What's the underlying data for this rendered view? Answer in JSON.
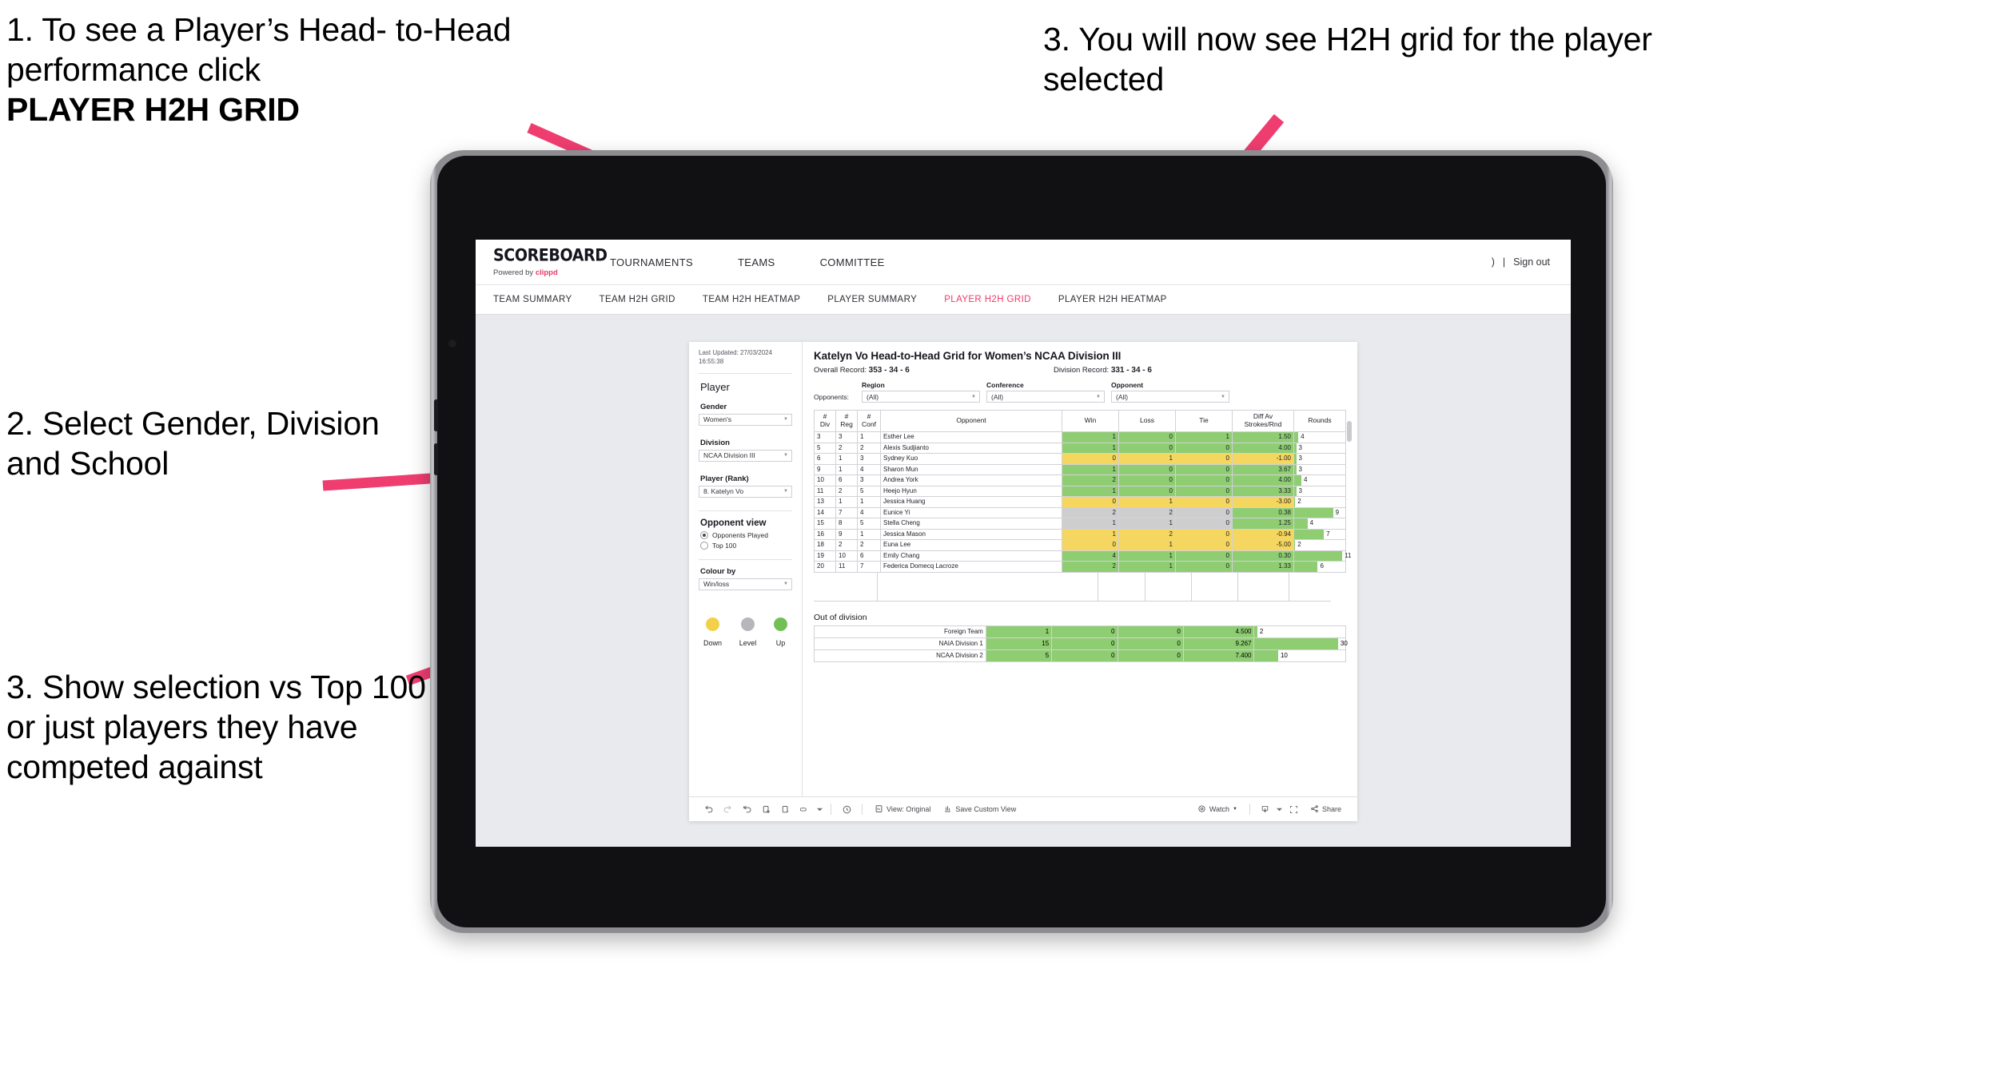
{
  "annotations": [
    {
      "id": "anno1",
      "line1": "1. To see a Player’s Head-",
      "line2": "to-Head performance click",
      "line3": "PLAYER H2H GRID"
    },
    {
      "id": "anno2",
      "text": "2. Select Gender, Division and School"
    },
    {
      "id": "anno3",
      "text": "3. Show selection vs Top 100 or just players they have competed against"
    },
    {
      "id": "anno4",
      "text": "3. You will now see H2H grid for the player selected"
    }
  ],
  "app": {
    "logo": {
      "main": "SCOREBOARD",
      "powered_prefix": "Powered by ",
      "powered_brand": "clippd"
    },
    "top_nav": [
      "TOURNAMENTS",
      "TEAMS",
      "COMMITTEE"
    ],
    "top_right": {
      "user": ")",
      "sep": "|",
      "signout": "Sign out"
    },
    "subnav": [
      {
        "label": "TEAM SUMMARY",
        "active": false
      },
      {
        "label": "TEAM H2H GRID",
        "active": false
      },
      {
        "label": "TEAM H2H HEATMAP",
        "active": false
      },
      {
        "label": "PLAYER SUMMARY",
        "active": false
      },
      {
        "label": "PLAYER H2H GRID",
        "active": true
      },
      {
        "label": "PLAYER H2H HEATMAP",
        "active": false
      }
    ],
    "accent_color": "#ec3a6b"
  },
  "sidebar": {
    "last_updated": "Last Updated: 27/03/2024 16:55:38",
    "player_heading": "Player",
    "gender": {
      "label": "Gender",
      "value": "Women's"
    },
    "division": {
      "label": "Division",
      "value": "NCAA Division III"
    },
    "player_rank": {
      "label": "Player (Rank)",
      "value": "8. Katelyn Vo"
    },
    "opponent_view": {
      "heading": "Opponent view",
      "options": [
        {
          "label": "Opponents Played",
          "selected": true
        },
        {
          "label": "Top 100",
          "selected": false
        }
      ]
    },
    "colour_by": {
      "label": "Colour by",
      "value": "Win/loss"
    },
    "legend": [
      {
        "label": "Down",
        "color": "#f2d049"
      },
      {
        "label": "Level",
        "color": "#b6b6bb"
      },
      {
        "label": "Up",
        "color": "#72bf56"
      }
    ]
  },
  "viz": {
    "title": "Katelyn Vo Head-to-Head Grid for Women’s NCAA Division III",
    "overall_record_label": "Overall Record: ",
    "overall_record_value": "353 -  34 - 6",
    "division_record_label": "Division Record: ",
    "division_record_value": "331 -  34 - 6",
    "opponents_label": "Opponents:",
    "filters": [
      {
        "label": "Region",
        "value": "(All)"
      },
      {
        "label": "Conference",
        "value": "(All)"
      },
      {
        "label": "Opponent",
        "value": "(All)"
      }
    ],
    "out_of_division_title": "Out of division"
  },
  "chart_data": {
    "type": "table",
    "title": "Katelyn Vo Head-to-Head Grid for Women’s NCAA Division III",
    "columns": [
      "# Div",
      "# Reg",
      "# Conf",
      "Opponent",
      "Win",
      "Loss",
      "Tie",
      "Diff Av Strokes/Rnd",
      "Rounds"
    ],
    "header_lines": [
      [
        "#",
        "Div"
      ],
      [
        "#",
        "Reg"
      ],
      [
        "#",
        "Conf"
      ],
      [
        "Opponent",
        ""
      ],
      [
        "Win",
        ""
      ],
      [
        "Loss",
        ""
      ],
      [
        "Tie",
        ""
      ],
      [
        "Diff Av",
        "Strokes/Rnd"
      ],
      [
        "Rounds",
        ""
      ]
    ],
    "colour_scale": {
      "up": "#8fcd72",
      "level": "#cececf",
      "down": "#f5d65e",
      "rounds_bar": "#8fcd72"
    },
    "rows": [
      {
        "div": "3",
        "reg": "3",
        "conf": "1",
        "opponent": "Esther Lee",
        "win": "1",
        "loss": "0",
        "tie": "1",
        "diff": "1.50",
        "rounds": "4",
        "color": "up",
        "rounds_bar_pct": 8
      },
      {
        "div": "5",
        "reg": "2",
        "conf": "2",
        "opponent": "Alexis Sudjianto",
        "win": "1",
        "loss": "0",
        "tie": "0",
        "diff": "4.00",
        "rounds": "3",
        "color": "up",
        "rounds_bar_pct": 4
      },
      {
        "div": "6",
        "reg": "1",
        "conf": "3",
        "opponent": "Sydney Kuo",
        "win": "0",
        "loss": "1",
        "tie": "0",
        "diff": "-1.00",
        "rounds": "3",
        "color": "down",
        "rounds_bar_pct": 4
      },
      {
        "div": "9",
        "reg": "1",
        "conf": "4",
        "opponent": "Sharon Mun",
        "win": "1",
        "loss": "0",
        "tie": "0",
        "diff": "3.67",
        "rounds": "3",
        "color": "up",
        "rounds_bar_pct": 4
      },
      {
        "div": "10",
        "reg": "6",
        "conf": "3",
        "opponent": "Andrea York",
        "win": "2",
        "loss": "0",
        "tie": "0",
        "diff": "4.00",
        "rounds": "4",
        "color": "up",
        "rounds_bar_pct": 14
      },
      {
        "div": "11",
        "reg": "2",
        "conf": "5",
        "opponent": "Heejo Hyun",
        "win": "1",
        "loss": "0",
        "tie": "0",
        "diff": "3.33",
        "rounds": "3",
        "color": "up",
        "rounds_bar_pct": 4
      },
      {
        "div": "13",
        "reg": "1",
        "conf": "1",
        "opponent": "Jessica Huang",
        "win": "0",
        "loss": "1",
        "tie": "0",
        "diff": "-3.00",
        "rounds": "2",
        "color": "down",
        "rounds_bar_pct": 2
      },
      {
        "div": "14",
        "reg": "7",
        "conf": "4",
        "opponent": "Eunice Yi",
        "win": "2",
        "loss": "2",
        "tie": "0",
        "diff": "0.38",
        "rounds": "9",
        "color": "level",
        "diff_color": "up",
        "rounds_bar_pct": 76
      },
      {
        "div": "15",
        "reg": "8",
        "conf": "5",
        "opponent": "Stella Cheng",
        "win": "1",
        "loss": "1",
        "tie": "0",
        "diff": "1.25",
        "rounds": "4",
        "color": "level",
        "diff_color": "up",
        "rounds_bar_pct": 26
      },
      {
        "div": "16",
        "reg": "9",
        "conf": "1",
        "opponent": "Jessica Mason",
        "win": "1",
        "loss": "2",
        "tie": "0",
        "diff": "-0.94",
        "rounds": "7",
        "color": "down",
        "rounds_bar_pct": 58
      },
      {
        "div": "18",
        "reg": "2",
        "conf": "2",
        "opponent": "Euna Lee",
        "win": "0",
        "loss": "1",
        "tie": "0",
        "diff": "-5.00",
        "rounds": "2",
        "color": "down",
        "rounds_bar_pct": 2
      },
      {
        "div": "19",
        "reg": "10",
        "conf": "6",
        "opponent": "Emily Chang",
        "win": "4",
        "loss": "1",
        "tie": "0",
        "diff": "0.30",
        "rounds": "11",
        "color": "up",
        "rounds_bar_pct": 94
      },
      {
        "div": "20",
        "reg": "11",
        "conf": "7",
        "opponent": "Federica Domecq Lacroze",
        "win": "2",
        "loss": "1",
        "tie": "0",
        "diff": "1.33",
        "rounds": "6",
        "color": "up",
        "rounds_bar_pct": 46
      }
    ],
    "out_of_division": [
      {
        "name": "Foreign Team",
        "win": "1",
        "loss": "0",
        "tie": "0",
        "diff": "4.500",
        "rounds": "2",
        "color": "up",
        "rounds_bar_pct": 3
      },
      {
        "name": "NAIA Division 1",
        "win": "15",
        "loss": "0",
        "tie": "0",
        "diff": "9.267",
        "rounds": "30",
        "color": "up",
        "rounds_bar_pct": 92
      },
      {
        "name": "NCAA Division 2",
        "win": "5",
        "loss": "0",
        "tie": "0",
        "diff": "7.400",
        "rounds": "10",
        "color": "up",
        "rounds_bar_pct": 26
      }
    ]
  },
  "toolbar": {
    "icons": [
      "undo-icon",
      "redo-icon",
      "revert-icon",
      "refresh-icon",
      "pause-icon",
      "shape-icon",
      "caret-icon",
      "clock-icon"
    ],
    "view_original": "View: Original",
    "save_custom_view": "Save Custom View",
    "watch": "Watch",
    "share": "Share"
  }
}
